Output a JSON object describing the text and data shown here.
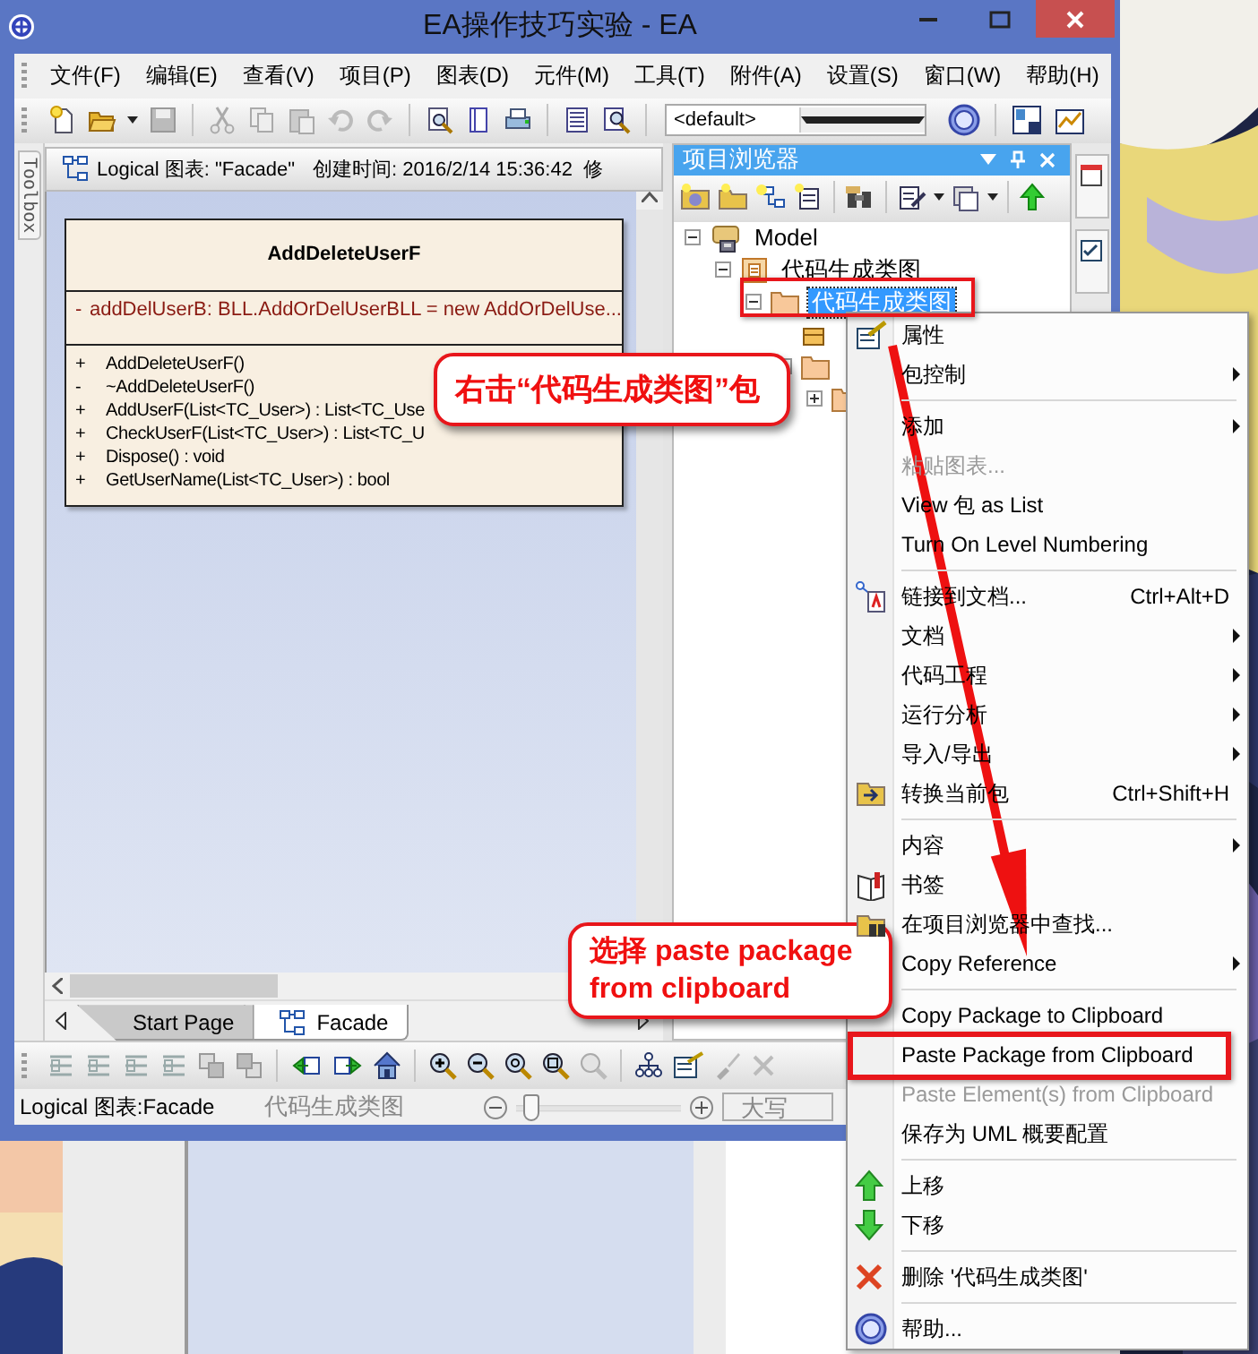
{
  "window": {
    "title": "EA操作技巧实验 - EA"
  },
  "menu_bar": [
    "文件(F)",
    "编辑(E)",
    "查看(V)",
    "项目(P)",
    "图表(D)",
    "元件(M)",
    "工具(T)",
    "附件(A)",
    "设置(S)",
    "窗口(W)",
    "帮助(H)"
  ],
  "toolbar": {
    "view_dropdown": "<default>"
  },
  "toolbox": {
    "label": "Toolbox"
  },
  "diagram": {
    "header": {
      "title": "Logical 图表: \"Facade\"",
      "created": "创建时间: 2016/2/14 15:36:42",
      "cut": "修"
    },
    "class": {
      "name": "AddDeleteUserF",
      "attributes": [
        {
          "visibility": "-",
          "text": "addDelUserB:  BLL.AddOrDelUserBLL = new AddOrDelUse..."
        }
      ],
      "operations": [
        {
          "visibility": "+",
          "text": "AddDeleteUserF()"
        },
        {
          "visibility": "-",
          "text": "~AddDeleteUserF()"
        },
        {
          "visibility": "+",
          "text": "AddUserF(List<TC_User>) : List<TC_Use"
        },
        {
          "visibility": "+",
          "text": "CheckUserF(List<TC_User>) : List<TC_U"
        },
        {
          "visibility": "+",
          "text": "Dispose() : void"
        },
        {
          "visibility": "+",
          "text": "GetUserName(List<TC_User>) : bool"
        }
      ]
    },
    "tabs": [
      {
        "label": "Start Page",
        "selected": false
      },
      {
        "label": "Facade",
        "selected": true
      }
    ]
  },
  "project_browser": {
    "title": "项目浏览器",
    "tree": [
      {
        "label": "Model",
        "kind": "model",
        "expanded": true,
        "selected": false,
        "children": [
          {
            "label": "代码生成类图",
            "kind": "package",
            "expanded": true,
            "selected": false,
            "children": [
              {
                "label": "代码生成类图",
                "kind": "folder",
                "expanded": true,
                "selected": true,
                "children": [
                  {
                    "kind": "class",
                    "selected": false
                  },
                  {
                    "kind": "folder",
                    "expanded": true,
                    "selected": false,
                    "children": [
                      {
                        "kind": "folder",
                        "expanded": false,
                        "selected": false
                      }
                    ]
                  }
                ]
              }
            ]
          }
        ]
      }
    ]
  },
  "status_bar": {
    "diagram": "Logical 图表:Facade",
    "package": "代码生成类图",
    "zoom": {
      "level": 0.05
    },
    "caps_field": "大写"
  },
  "context_menu": [
    {
      "kind": "item",
      "label": "属性",
      "disabled": false,
      "submenu": false
    },
    {
      "kind": "item",
      "label": "包控制",
      "disabled": false,
      "submenu": true
    },
    {
      "kind": "separator"
    },
    {
      "kind": "item",
      "label": "添加",
      "disabled": false,
      "submenu": true
    },
    {
      "kind": "item",
      "label": "粘贴图表...",
      "disabled": true,
      "submenu": false
    },
    {
      "kind": "item",
      "label": "View 包 as List",
      "disabled": false,
      "submenu": false
    },
    {
      "kind": "item",
      "label": "Turn On Level Numbering",
      "disabled": false,
      "submenu": false
    },
    {
      "kind": "separator"
    },
    {
      "kind": "item",
      "label": "链接到文档...",
      "shortcut": "Ctrl+Alt+D",
      "disabled": false,
      "submenu": false
    },
    {
      "kind": "item",
      "label": "文档",
      "disabled": false,
      "submenu": true
    },
    {
      "kind": "item",
      "label": "代码工程",
      "disabled": false,
      "submenu": true
    },
    {
      "kind": "item",
      "label": "运行分析",
      "disabled": false,
      "submenu": true
    },
    {
      "kind": "item",
      "label": "导入/导出",
      "disabled": false,
      "submenu": true
    },
    {
      "kind": "item",
      "label": "转换当前包",
      "shortcut": "Ctrl+Shift+H",
      "disabled": false,
      "submenu": false
    },
    {
      "kind": "separator"
    },
    {
      "kind": "item",
      "label": "内容",
      "disabled": false,
      "submenu": true
    },
    {
      "kind": "item",
      "label": "书签",
      "disabled": false,
      "submenu": false
    },
    {
      "kind": "item",
      "label": "在项目浏览器中查找...",
      "disabled": false,
      "submenu": false
    },
    {
      "kind": "item",
      "label": "Copy Reference",
      "disabled": false,
      "submenu": true
    },
    {
      "kind": "separator"
    },
    {
      "kind": "item",
      "label": "Copy Package to Clipboard",
      "disabled": false,
      "submenu": false
    },
    {
      "kind": "item",
      "label": "Paste Package from Clipboard",
      "disabled": false,
      "submenu": false
    },
    {
      "kind": "item",
      "label": "Paste Element(s) from Clipboard",
      "disabled": true,
      "submenu": false
    },
    {
      "kind": "item",
      "label": "保存为 UML 概要配置",
      "disabled": false,
      "submenu": false
    },
    {
      "kind": "separator"
    },
    {
      "kind": "item",
      "label": "上移",
      "disabled": false,
      "submenu": false
    },
    {
      "kind": "item",
      "label": "下移",
      "disabled": false,
      "submenu": false
    },
    {
      "kind": "separator"
    },
    {
      "kind": "item",
      "label": "删除 '代码生成类图'",
      "disabled": false,
      "submenu": false
    },
    {
      "kind": "separator"
    },
    {
      "kind": "item",
      "label": "帮助...",
      "disabled": false,
      "submenu": false
    }
  ],
  "callouts": [
    "右击“代码生成类图”包",
    "选择 paste package from clipboard"
  ]
}
